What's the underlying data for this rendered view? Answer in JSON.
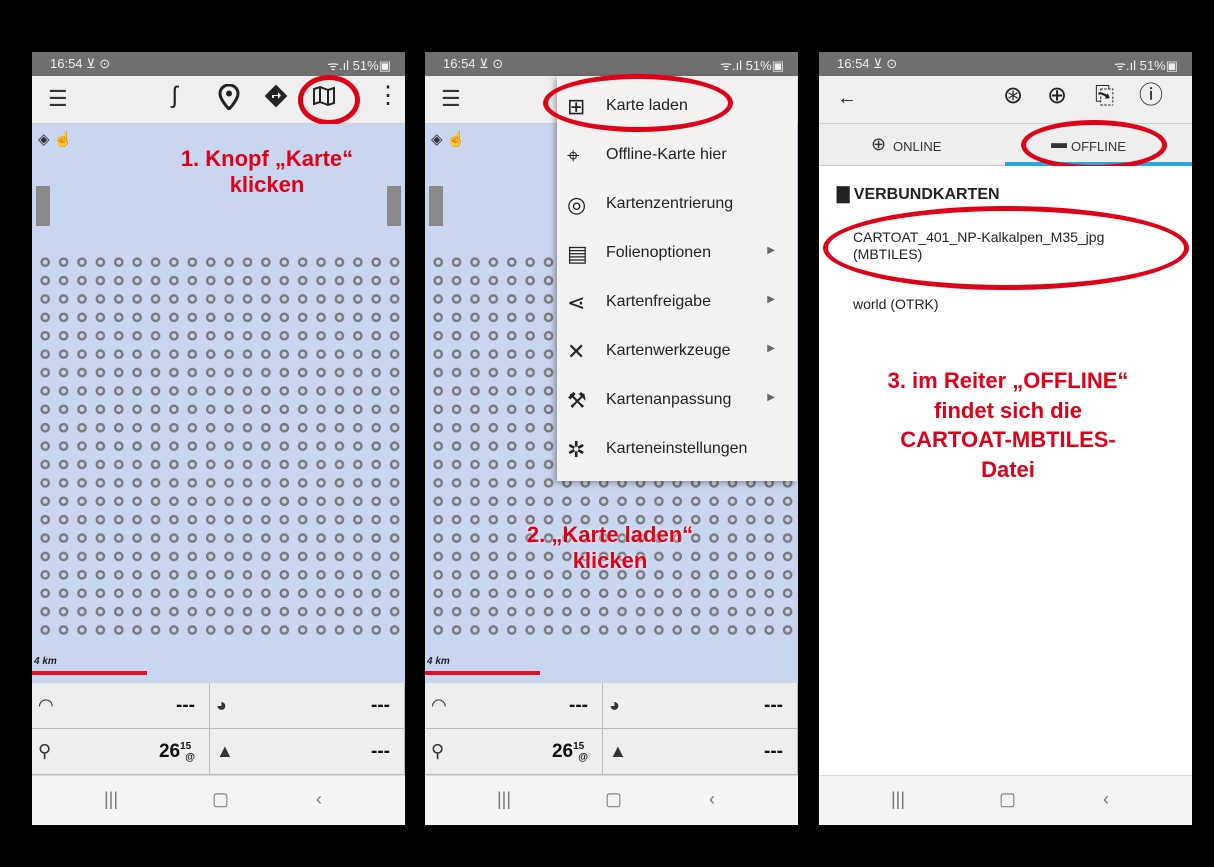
{
  "status": {
    "time": "16:54 ⊻ ⊙",
    "signal": "ᯤ.ıl 51%▣"
  },
  "panel1": {
    "annotation_line1": "1. Knopf „Karte“",
    "annotation_line2": "klicken",
    "scale": "4 km",
    "dash": {
      "speed": "---",
      "altitude": "---",
      "zoom": "26",
      "zoom_sup": "15",
      "zoom_sub": "@",
      "elev": "---"
    }
  },
  "panel2": {
    "menu": [
      {
        "label": "Karte laden",
        "icon": "map-icon"
      },
      {
        "label": "Offline-Karte hier",
        "icon": "map-pin-icon"
      },
      {
        "label": "Kartenzentrierung",
        "icon": "target-icon"
      },
      {
        "label": "Folienoptionen",
        "icon": "layers-icon",
        "submenu": true
      },
      {
        "label": "Kartenfreigabe",
        "icon": "share-icon",
        "submenu": true
      },
      {
        "label": "Kartenwerkzeuge",
        "icon": "tools-icon",
        "submenu": true
      },
      {
        "label": "Kartenanpassung",
        "icon": "wrench-icon",
        "submenu": true
      },
      {
        "label": "Karteneinstellungen",
        "icon": "gear-icon"
      }
    ],
    "annotation_line1": "2. „Karte laden“",
    "annotation_line2": "klicken",
    "scale": "4 km",
    "dash": {
      "speed": "---",
      "altitude": "---",
      "zoom": "26",
      "zoom_sup": "15",
      "zoom_sub": "@",
      "elev": "---"
    }
  },
  "panel3": {
    "tabs": {
      "online": "ONLINE",
      "offline": "OFFLINE"
    },
    "section": "VERBUNDKARTEN",
    "items": [
      "CARTOAT_401_NP-Kalkalpen_M35_jpg (MBTILES)",
      "world (OTRK)"
    ],
    "annotation": [
      "3. im Reiter „OFFLINE“",
      "findet sich die",
      "CARTOAT-MBTILES-",
      "Datei"
    ]
  },
  "colors": {
    "annotation": "#e00018",
    "map": "#c9d6ef",
    "scale": "#e0102a",
    "tab_active": "#29a8e0"
  }
}
